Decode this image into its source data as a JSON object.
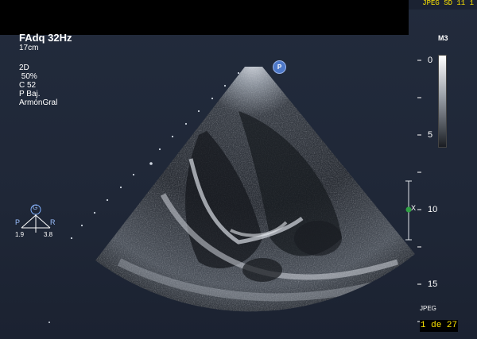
{
  "header": {
    "mode_line": "FAdq 32Hz",
    "depth_line": "17cm",
    "top_right": "JPEG SD  11  1",
    "right_mode": "M3"
  },
  "params": [
    "2D",
    " 50%",
    "C 52",
    "P Baj.",
    "ArmónGral"
  ],
  "orientation": {
    "top_label": "G",
    "left_label": "P",
    "right_label": "R",
    "left_value": "1.9",
    "right_value": "3.8"
  },
  "probe_marker": "P",
  "focus_marker": "X",
  "gray_scale": {
    "top": "0",
    "bottom": "5"
  },
  "depth_scale": {
    "mid": "10",
    "bottom": "15"
  },
  "footer": {
    "format": "JPEG",
    "pager": "1 de 27"
  },
  "colors": {
    "accent_yellow": "#ffe600",
    "background": "#1f2737",
    "probe_blue": "#4d78c8",
    "focus_green": "#2ea043"
  }
}
